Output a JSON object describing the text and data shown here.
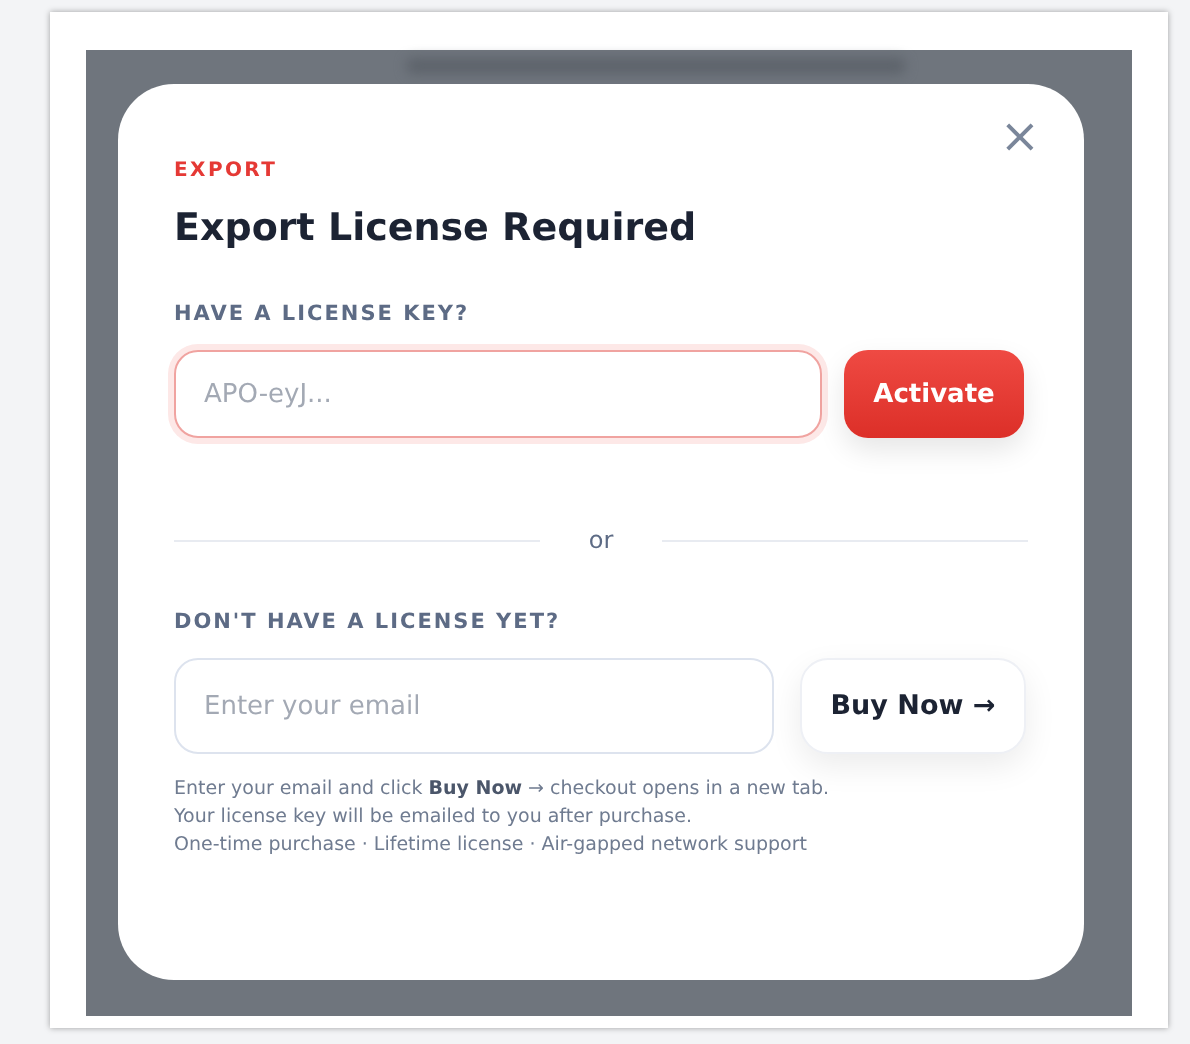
{
  "dialog": {
    "eyebrow": "EXPORT",
    "title": "Export License Required",
    "close_glyph": "×",
    "license_section": {
      "label": "HAVE A LICENSE KEY?",
      "field": {
        "placeholder": "APO-eyJ...",
        "focused": true
      },
      "button": "Activate"
    },
    "divider": "or",
    "purchase_section": {
      "label": "DON'T HAVE A LICENSE YET?",
      "field": {
        "placeholder": "Enter your email",
        "focused": false
      },
      "button": "Buy Now →"
    },
    "notes": [
      "Enter your email and click **Buy Now** → checkout opens in a new tab.",
      "Your license key will be emailed to you after purchase.",
      "One-time purchase · Lifetime license · Air-gapped network support"
    ]
  }
}
